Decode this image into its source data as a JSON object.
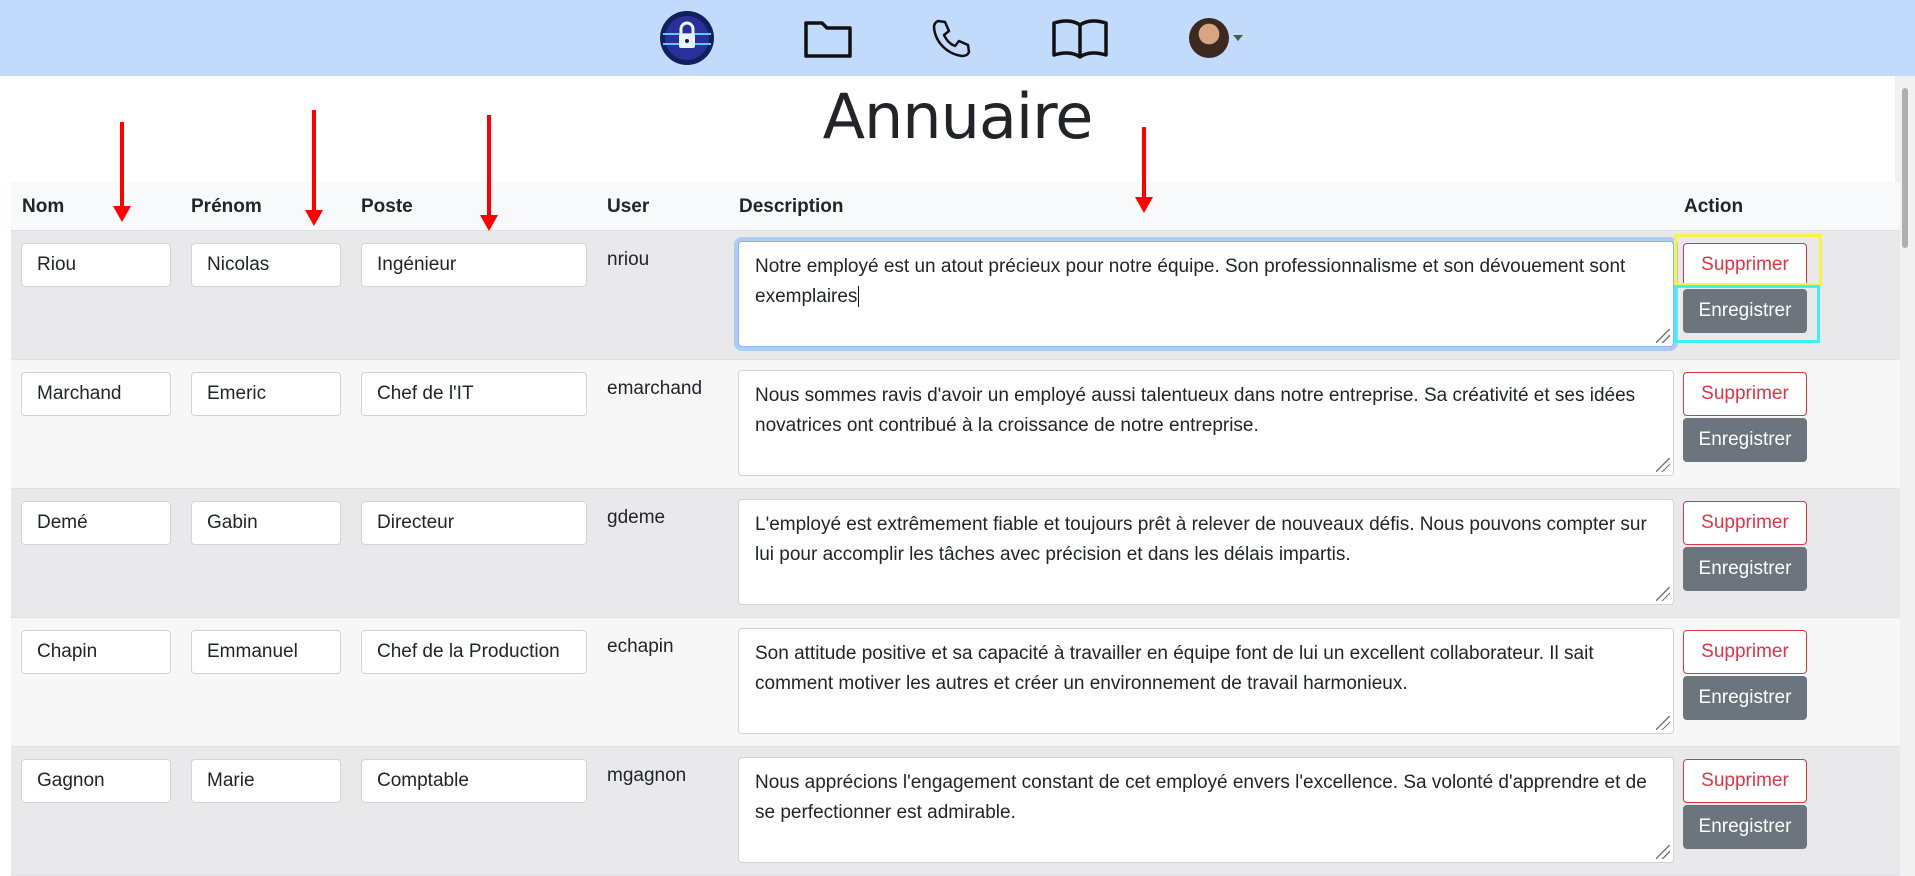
{
  "nav": {
    "logo": "lock-logo-icon",
    "items": [
      "folder-icon",
      "phone-icon",
      "book-icon"
    ],
    "profile": "avatar"
  },
  "page": {
    "title": "Annuaire"
  },
  "table": {
    "headers": {
      "nom": "Nom",
      "prenom": "Prénom",
      "poste": "Poste",
      "user": "User",
      "description": "Description",
      "action": "Action"
    },
    "rows": [
      {
        "nom": "Riou",
        "prenom": "Nicolas",
        "poste": "Ingénieur",
        "user": "nriou",
        "description": "Notre employé est un atout précieux pour notre équipe. Son professionnalisme et son dévouement sont exemplaires"
      },
      {
        "nom": "Marchand",
        "prenom": "Emeric",
        "poste": "Chef de l'IT",
        "user": "emarchand",
        "description": "Nous sommes ravis d'avoir un employé aussi talentueux dans notre entreprise. Sa créativité et ses idées novatrices ont contribué à la croissance de notre entreprise."
      },
      {
        "nom": "Demé",
        "prenom": "Gabin",
        "poste": "Directeur",
        "user": "gdeme",
        "description": "L'employé est extrêmement fiable et toujours prêt à relever de nouveaux défis. Nous pouvons compter sur lui pour accomplir les tâches avec précision et dans les délais impartis."
      },
      {
        "nom": "Chapin",
        "prenom": "Emmanuel",
        "poste": "Chef de la Production",
        "user": "echapin",
        "description": "Son attitude positive et sa capacité à travailler en équipe font de lui un excellent collaborateur. Il sait comment motiver les autres et créer un environnement de travail harmonieux."
      },
      {
        "nom": "Gagnon",
        "prenom": "Marie",
        "poste": "Comptable",
        "user": "mgagnon",
        "description": "Nous apprécions l'engagement constant de cet employé envers l'excellence. Sa volonté d'apprendre et de se perfectionner est admirable."
      }
    ],
    "buttons": {
      "delete": "Supprimer",
      "save": "Enregistrer"
    }
  },
  "colors": {
    "navbar": "#c2dafc",
    "danger": "#dc3545",
    "secondary": "#6c757d",
    "annotation_arrow": "#ff0000",
    "highlight_yellow": "#f8f24a",
    "highlight_cyan": "#3ef0f0"
  }
}
